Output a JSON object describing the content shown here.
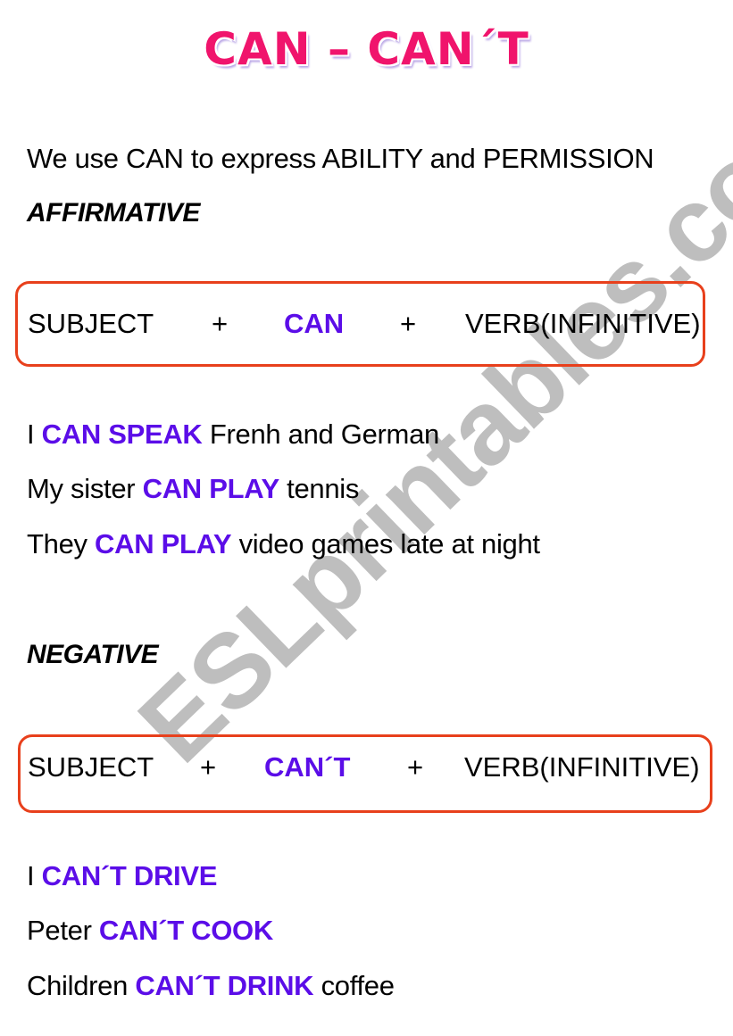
{
  "title": "CAN – CAN´T",
  "intro": "We use CAN to express ABILITY and PERMISSION",
  "colors": {
    "title": "#f0146c",
    "keyword": "#5b0de8",
    "box_border": "#e8401c",
    "watermark": "#8c8c8c"
  },
  "affirmative": {
    "heading": "AFFIRMATIVE",
    "formula": {
      "subject": "SUBJECT",
      "plus1": "+",
      "modal": "CAN",
      "plus2": "+",
      "verb": "VERB(INFINITIVE)"
    },
    "examples": [
      {
        "pre": "I ",
        "kw": "CAN SPEAK",
        "post": " Frenh and German"
      },
      {
        "pre": "My sister ",
        "kw": "CAN PLAY",
        "post": " tennis"
      },
      {
        "pre": "They ",
        "kw": "CAN PLAY",
        "post": " video games late at night"
      }
    ]
  },
  "negative": {
    "heading": "NEGATIVE",
    "formula": {
      "subject": "SUBJECT",
      "plus1": "+",
      "modal": "CAN´T",
      "plus2": "+",
      "verb": "VERB(INFINITIVE)"
    },
    "examples": [
      {
        "pre": "I ",
        "kw": "CAN´T DRIVE",
        "post": ""
      },
      {
        "pre": "Peter ",
        "kw": "CAN´T COOK",
        "post": ""
      },
      {
        "pre": "Children ",
        "kw": "CAN´T DRINK",
        "post": " coffee"
      }
    ]
  },
  "watermark": "ESLprintables.com"
}
